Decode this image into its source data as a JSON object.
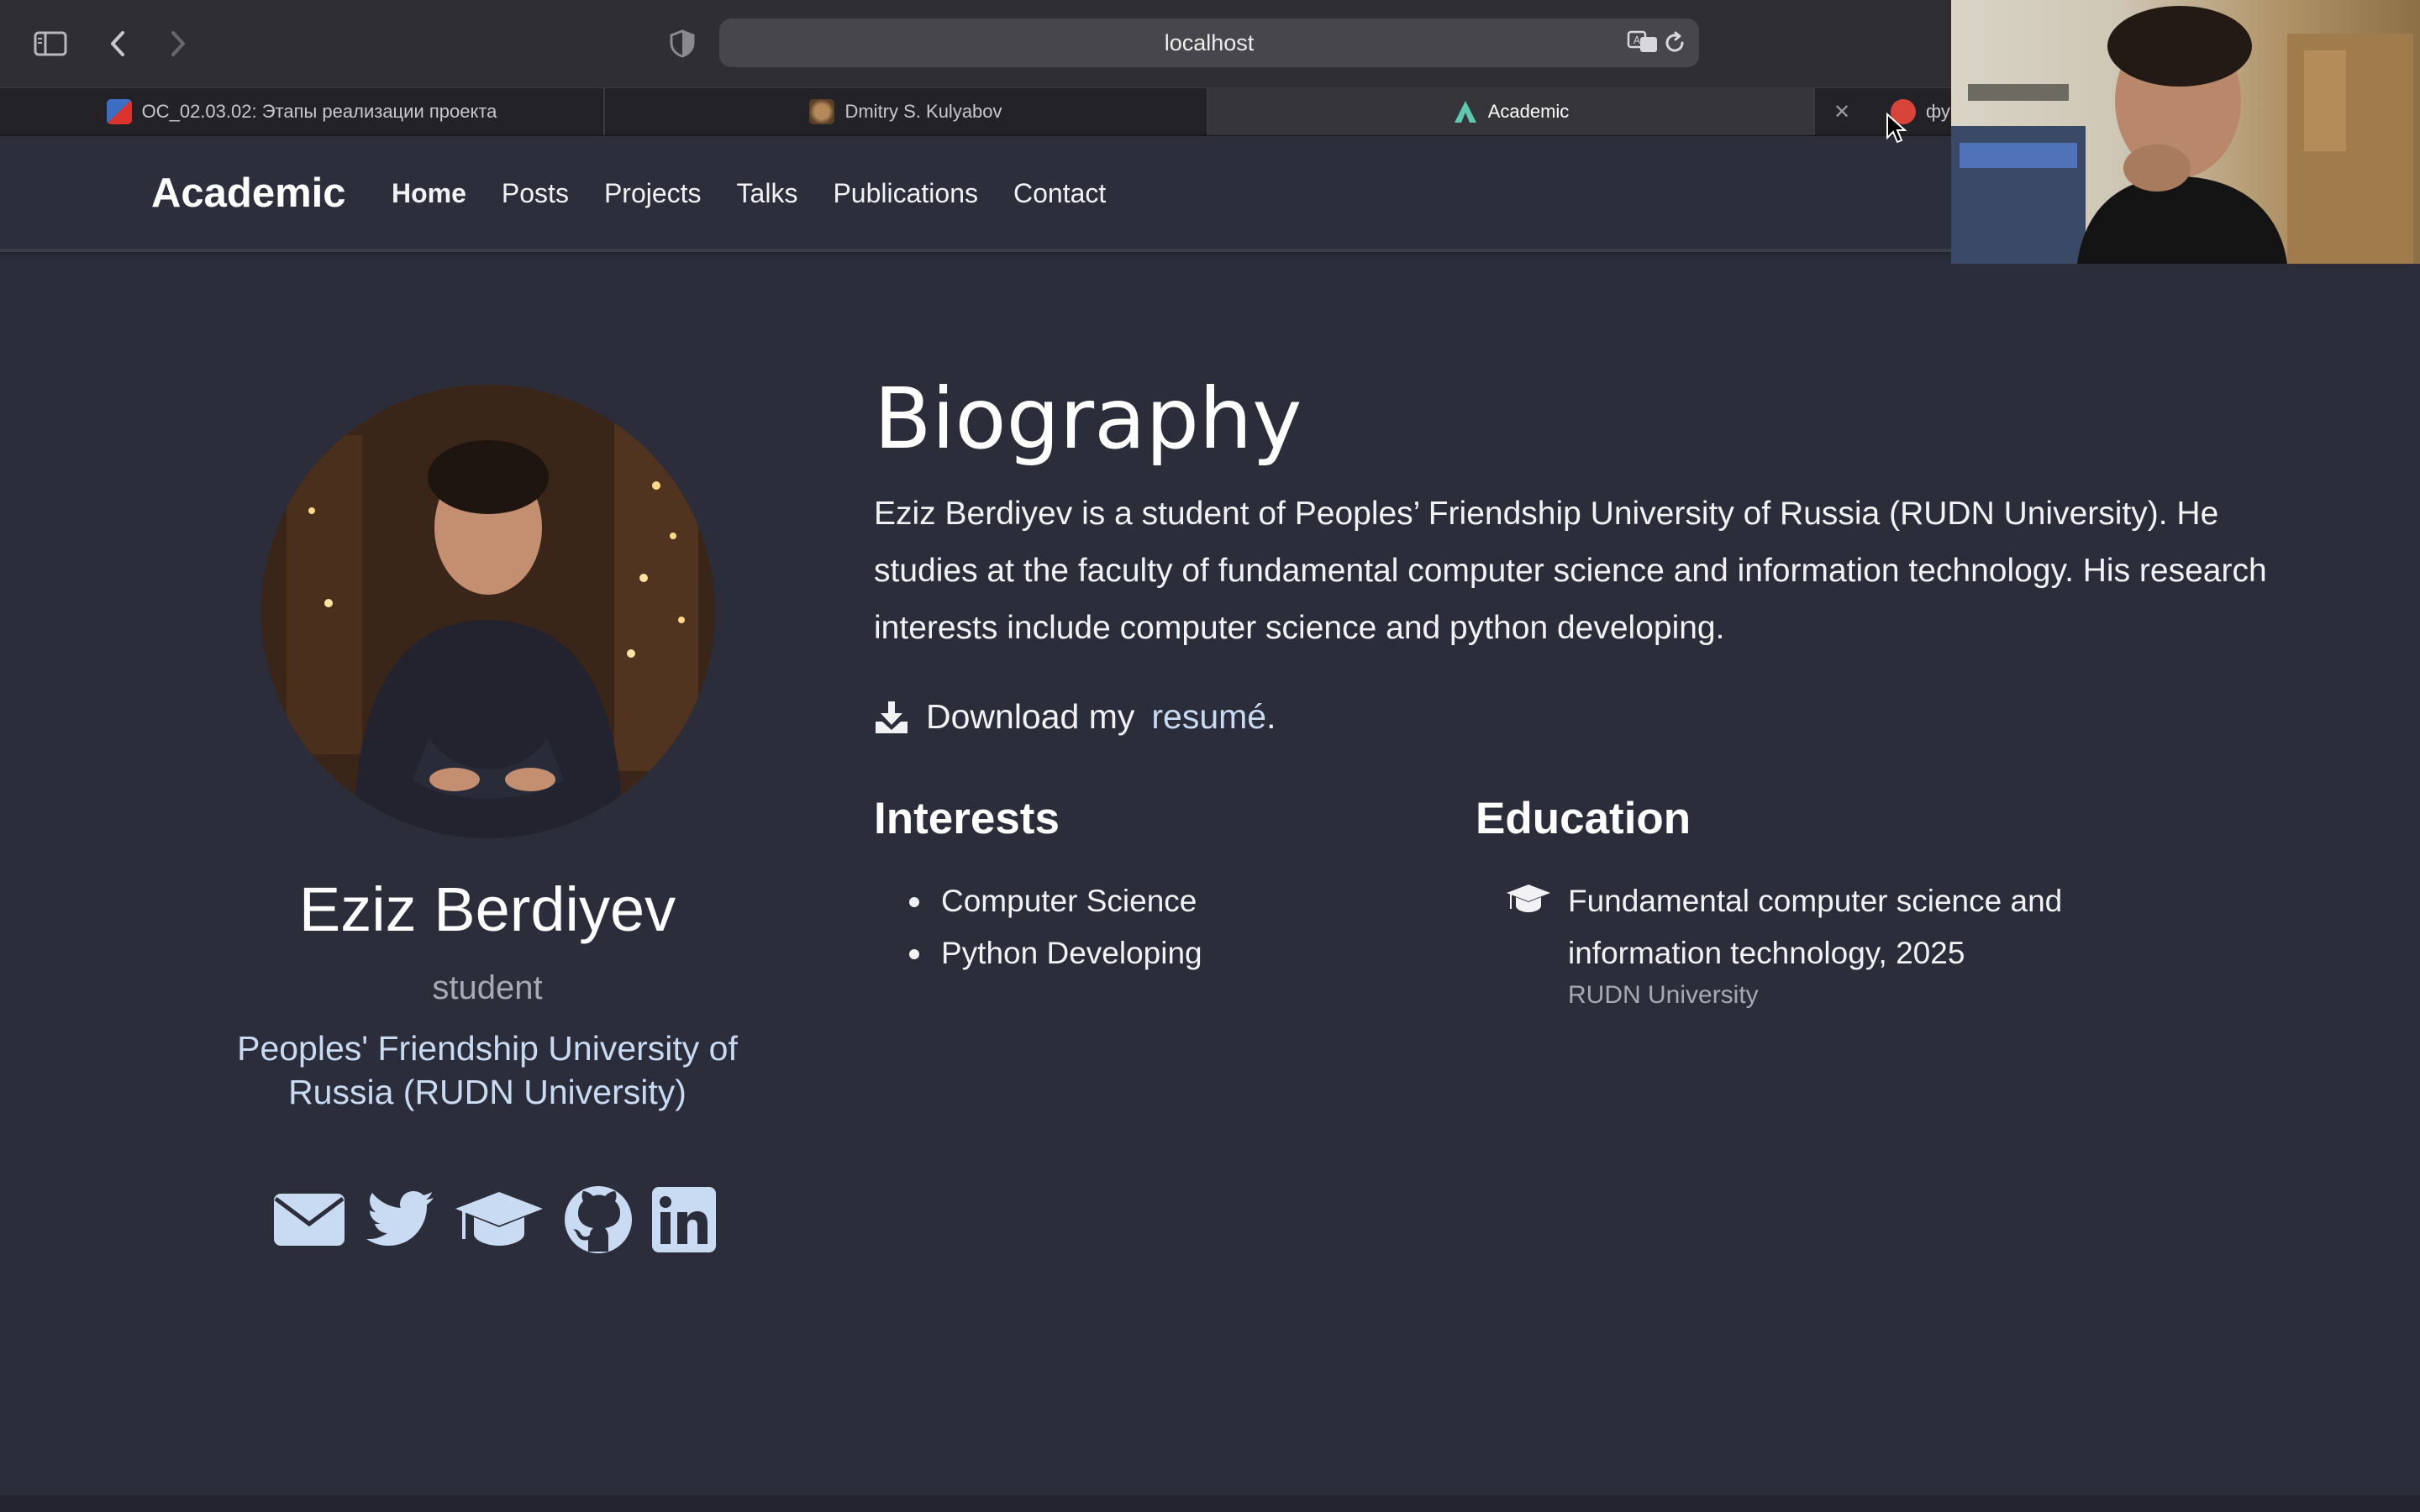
{
  "browser": {
    "url": "localhost",
    "tabs": [
      {
        "label": "ОС_02.03.02: Этапы реализации проекта",
        "active": false
      },
      {
        "label": "Dmitry S. Kulyabov",
        "active": false
      },
      {
        "label": "Academic",
        "active": true
      },
      {
        "label": "фунда",
        "active": false
      }
    ]
  },
  "site": {
    "brand": "Academic",
    "nav": [
      "Home",
      "Posts",
      "Projects",
      "Talks",
      "Publications",
      "Contact"
    ]
  },
  "profile": {
    "name": "Eziz Berdiyev",
    "role": "student",
    "organization": "Peoples' Friendship University of Russia (RUDN University)",
    "social_icons": [
      "envelope-icon",
      "twitter-icon",
      "graduation-cap-icon",
      "github-icon",
      "linkedin-icon"
    ]
  },
  "biography": {
    "title": "Biography",
    "text": "Eziz Berdiyev is a student of Peoples’ Friendship University of Russia (RUDN University). He studies at the faculty of fundamental computer science and information technology. His research interests include computer science and python developing.",
    "download_prefix": "Download my",
    "download_link": "resumé",
    "download_suffix": "."
  },
  "interests": {
    "title": "Interests",
    "items": [
      "Computer Science",
      "Python Developing"
    ]
  },
  "education": {
    "title": "Education",
    "course": "Fundamental computer science and information technology, 2025",
    "institution": "RUDN University"
  },
  "colors": {
    "page_bg": "#2b2d3a",
    "link": "#c9dbf2",
    "muted": "#a8a9b2"
  }
}
